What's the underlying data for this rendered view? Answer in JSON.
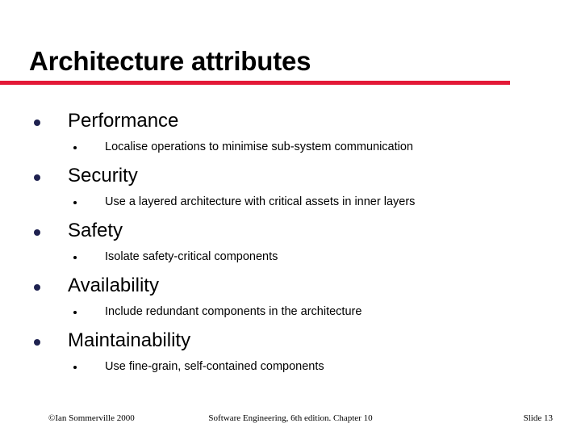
{
  "slide": {
    "title": "Architecture attributes",
    "accent_color": "#E31937",
    "bullet_color": "#1F2250",
    "background_color": "#FFFFFF"
  },
  "attributes": [
    {
      "name": "Performance",
      "detail": "Localise operations to minimise sub-system communication"
    },
    {
      "name": "Security",
      "detail": "Use a layered architecture with critical assets in inner layers"
    },
    {
      "name": "Safety",
      "detail": "Isolate safety-critical components"
    },
    {
      "name": "Availability",
      "detail": "Include redundant components in the architecture"
    },
    {
      "name": "Maintainability",
      "detail": "Use fine-grain, self-contained components"
    }
  ],
  "footer": {
    "copyright": "©Ian Sommerville 2000",
    "center": "Software Engineering, 6th edition. Chapter 10",
    "slide_number": "Slide 13"
  }
}
